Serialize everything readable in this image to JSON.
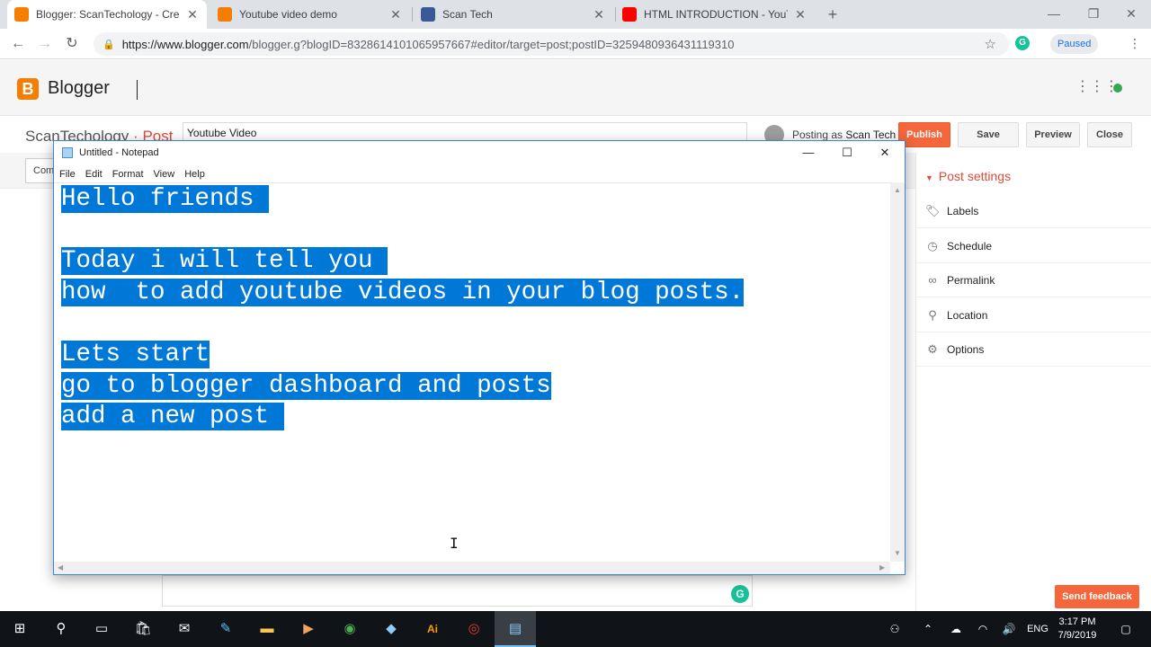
{
  "browser": {
    "tabs": [
      {
        "title": "Blogger: ScanTechology - Create",
        "favicon_color": "#f57d00",
        "active": true
      },
      {
        "title": "Youtube video demo",
        "favicon_color": "#f57d00",
        "active": false
      },
      {
        "title": "Scan Tech",
        "favicon_color": "#3b5998",
        "active": false
      },
      {
        "title": "HTML INTRODUCTION - YouTube",
        "favicon_color": "#ff0000",
        "active": false
      }
    ],
    "new_tab": "+",
    "url_host": "https://www.blogger.com",
    "url_path": "/blogger.g?blogID=8328614101065957667#editor/target=post;postID=3259480936431119310",
    "profile_status": "Paused"
  },
  "blogger": {
    "brand": "Blogger",
    "logo_letter": "B",
    "blog_name": "ScanTechology",
    "crumb_sep": "·",
    "crumb_section": "Post",
    "post_title": "Youtube Video",
    "posting_as_label": "Posting as",
    "posting_as_user": "Scan Tech",
    "buttons": {
      "publish": "Publish",
      "save": "Save",
      "preview": "Preview",
      "close": "Close"
    },
    "compose_tab": "Com",
    "post_settings": {
      "heading": "Post settings",
      "items": [
        {
          "label": "Labels",
          "icon": "tag-icon",
          "glyph": "🏷"
        },
        {
          "label": "Schedule",
          "icon": "clock-icon",
          "glyph": "◷"
        },
        {
          "label": "Permalink",
          "icon": "link-icon",
          "glyph": "∞"
        },
        {
          "label": "Location",
          "icon": "location-pin-icon",
          "glyph": "⚲"
        },
        {
          "label": "Options",
          "icon": "gear-icon",
          "glyph": "⚙"
        }
      ]
    },
    "send_feedback": "Send feedback",
    "grammarly_letter": "G"
  },
  "notepad": {
    "title": "Untitled - Notepad",
    "menu": [
      "File",
      "Edit",
      "Format",
      "View",
      "Help"
    ],
    "lines": [
      "Hello friends ",
      "",
      "Today i will tell you ",
      "how  to add youtube videos in your blog posts.",
      "",
      "Lets start",
      "go to blogger dashboard and posts",
      "add a new post "
    ],
    "selection_color": "#0078d7"
  },
  "taskbar": {
    "language": "ENG",
    "time": "3:17 PM",
    "date": "7/9/2019"
  }
}
